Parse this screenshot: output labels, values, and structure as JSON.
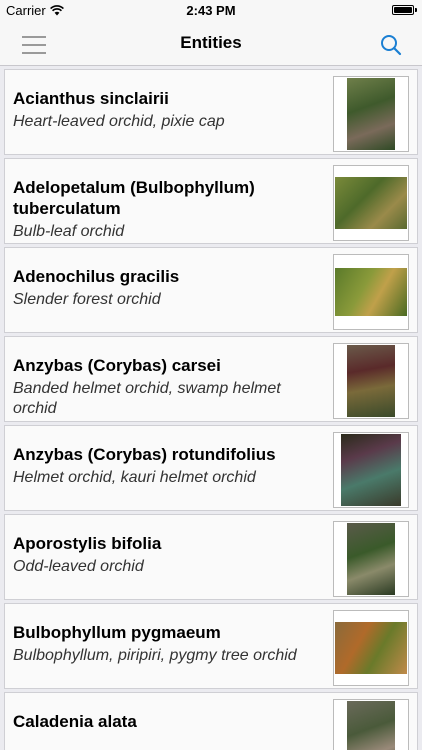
{
  "status_bar": {
    "carrier": "Carrier",
    "time": "2:43 PM"
  },
  "nav": {
    "title": "Entities",
    "menu_icon": "hamburger-menu-icon",
    "search_icon": "search-icon",
    "accent_color": "#1a7fd3"
  },
  "entities": [
    {
      "name": "Acianthus sinclairii",
      "common": "Heart-leaved orchid, pixie cap"
    },
    {
      "name": "Adelopetalum (Bulbophyllum) tuberculatum",
      "common": "Bulb-leaf orchid"
    },
    {
      "name": "Adenochilus gracilis",
      "common": "Slender forest orchid"
    },
    {
      "name": "Anzybas (Corybas) carsei",
      "common": "Banded helmet orchid, swamp helmet orchid"
    },
    {
      "name": "Anzybas (Corybas) rotundifolius",
      "common": "Helmet orchid, kauri helmet orchid"
    },
    {
      "name": "Aporostylis bifolia",
      "common": "Odd-leaved orchid"
    },
    {
      "name": "Bulbophyllum pygmaeum",
      "common": "Bulbophyllum, piripiri, pygmy tree orchid"
    },
    {
      "name": "Caladenia alata",
      "common": ""
    }
  ]
}
